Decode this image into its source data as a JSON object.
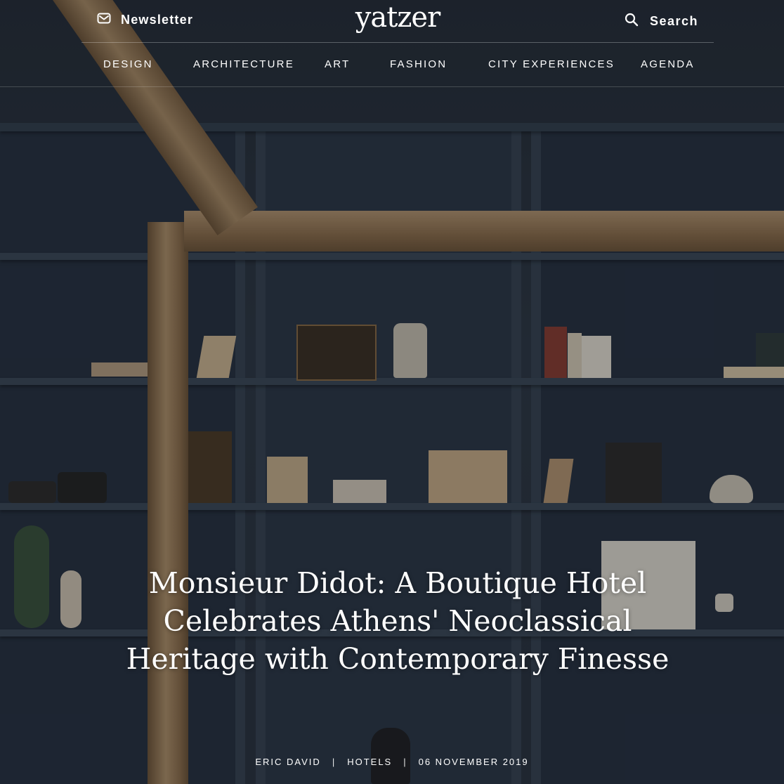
{
  "header": {
    "newsletter_label": "Newsletter",
    "logo_text": "yatzer",
    "search_label": "Search"
  },
  "nav": {
    "items": [
      {
        "label": "DESIGN"
      },
      {
        "label": "ARCHITECTURE"
      },
      {
        "label": "ART"
      },
      {
        "label": "FASHION"
      },
      {
        "label": "CITY EXPERIENCES"
      },
      {
        "label": "AGENDA"
      }
    ]
  },
  "article": {
    "title": "Monsieur Didot: A Boutique Hotel Celebrates Athens' Neoclassical Heritage with Contemporary Finesse",
    "author": "ERIC DAVID",
    "category": "HOTELS",
    "date": "06 NOVEMBER 2019"
  },
  "icons": {
    "newsletter": "envelope-icon",
    "search": "magnifier-icon"
  },
  "colors": {
    "text": "#ffffff",
    "wall": "#2c3644",
    "wood": "#a98b66"
  }
}
